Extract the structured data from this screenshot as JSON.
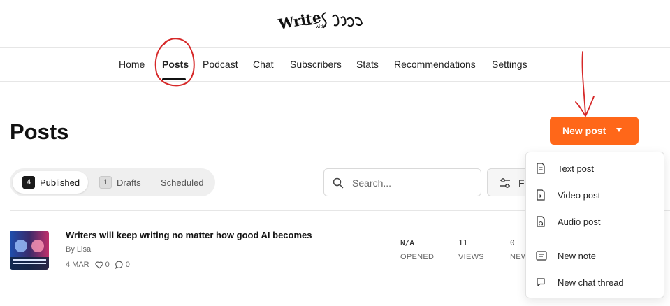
{
  "logo": {
    "alt": "Write with Lisa"
  },
  "nav": {
    "items": [
      {
        "label": "Home"
      },
      {
        "label": "Posts",
        "active": true
      },
      {
        "label": "Podcast"
      },
      {
        "label": "Chat"
      },
      {
        "label": "Subscribers"
      },
      {
        "label": "Stats"
      },
      {
        "label": "Recommendations"
      },
      {
        "label": "Settings"
      }
    ]
  },
  "page": {
    "title": "Posts"
  },
  "new_post": {
    "label": "New post",
    "menu": [
      {
        "label": "Text post",
        "icon": "document-icon"
      },
      {
        "label": "Video post",
        "icon": "video-file-icon"
      },
      {
        "label": "Audio post",
        "icon": "audio-file-icon"
      },
      {
        "label": "New note",
        "icon": "note-icon"
      },
      {
        "label": "New chat thread",
        "icon": "chat-bubble-icon"
      }
    ]
  },
  "tabs": [
    {
      "label": "Published",
      "count": "4",
      "active": true
    },
    {
      "label": "Drafts",
      "count": "1"
    },
    {
      "label": "Scheduled"
    }
  ],
  "search": {
    "placeholder": "Search..."
  },
  "filter": {
    "label": "F"
  },
  "posts": [
    {
      "title": "Writers will keep writing no matter how good AI becomes",
      "author": "By Lisa",
      "date": "4 MAR",
      "likes": "0",
      "comments": "0",
      "opened": "N/A",
      "opened_label": "OPENED",
      "views": "11",
      "views_label": "VIEWS",
      "third_value": "0",
      "third_label": "NEW"
    }
  ],
  "colors": {
    "accent": "#ff6719",
    "annotation": "#d62828",
    "text": "#1f1f1f"
  }
}
